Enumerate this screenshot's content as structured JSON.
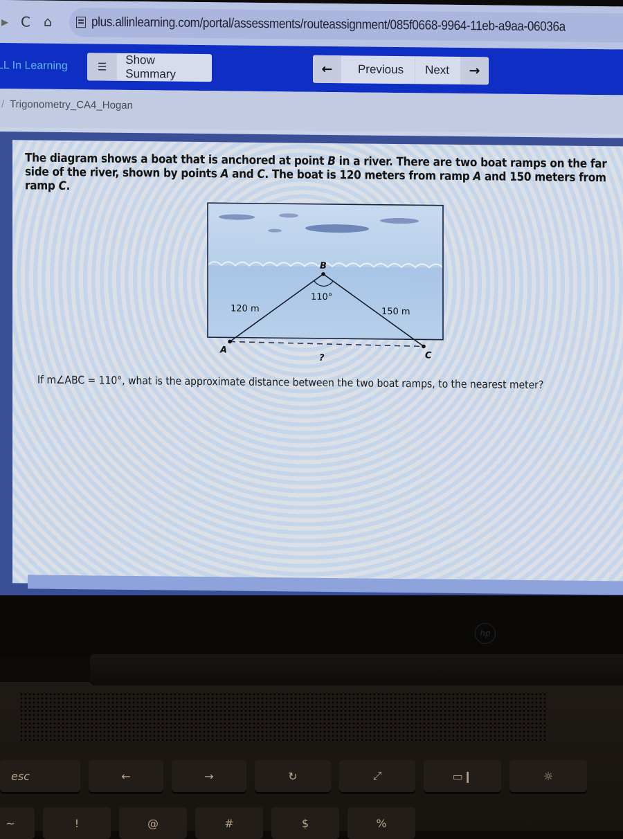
{
  "browser": {
    "back_icon": "▸",
    "reload_icon": "C",
    "home_icon": "⌂",
    "url": "plus.allinlearning.com/portal/assessments/routeassignment/085f0668-9964-11eb-a9aa-06036a"
  },
  "app": {
    "brand": "LL In Learning",
    "show_summary_label": "Show Summary",
    "summary_icon": "☰",
    "prev_arrow": "←",
    "previous_label": "Previous",
    "next_label": "Next",
    "next_arrow": "→",
    "accent_color": "#0f2fc4"
  },
  "breadcrumb": {
    "separator": "/",
    "item": "Trigonometry_CA4_Hogan"
  },
  "question": {
    "intro_part1": "The diagram shows a boat that is anchored at point ",
    "point_b": "B",
    "intro_part2": " in a river. There are two boat ramps on the far side of the river, shown by points ",
    "point_a": "A",
    "intro_and": " and ",
    "point_c": "C",
    "intro_part3": ". The boat is 120 meters from ramp ",
    "intro_a2": "A",
    "intro_part4": " and 150 meters from ramp ",
    "intro_c2": "C",
    "intro_end": ".",
    "prompt": "If m∠ABC = 110°, what is the approximate distance between the two boat ramps, to the nearest meter?"
  },
  "diagram": {
    "label_b": "B",
    "label_a": "A",
    "label_c": "C",
    "angle_label": "110°",
    "side_ab_label": "120 m",
    "side_bc_label": "150 m",
    "unknown_label": "?"
  },
  "keyboard": {
    "fn_row": [
      "esc",
      "←",
      "→",
      "↻",
      "⤢",
      "▭❙",
      "☼"
    ],
    "num_row": [
      "~",
      "!",
      "@",
      "#",
      "$",
      "%"
    ]
  }
}
